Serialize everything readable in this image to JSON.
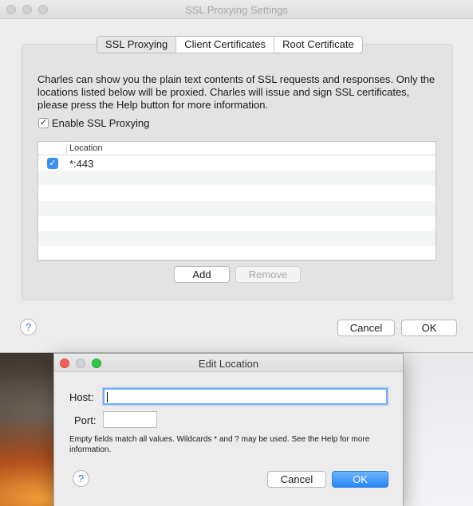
{
  "main_window": {
    "title": "SSL Proxying Settings",
    "tabs": [
      {
        "label": "SSL Proxying",
        "active": true
      },
      {
        "label": "Client Certificates",
        "active": false
      },
      {
        "label": "Root Certificate",
        "active": false
      }
    ],
    "description": "Charles can show you the plain text contents of SSL requests and responses. Only the locations listed below will be proxied. Charles will issue and sign SSL certificates, please press the Help button for more information.",
    "enable_checkbox": {
      "label": "Enable SSL Proxying",
      "checked": true
    },
    "table": {
      "column_header": "Location",
      "rows": [
        {
          "checked": true,
          "location": "*:443"
        }
      ]
    },
    "add_button": "Add",
    "remove_button": "Remove",
    "help_button": "?",
    "cancel_button": "Cancel",
    "ok_button": "OK"
  },
  "edit_dialog": {
    "title": "Edit Location",
    "host_label": "Host:",
    "host_value": "",
    "port_label": "Port:",
    "port_value": "",
    "hint": "Empty fields match all values. Wildcards * and ? may be used. See the Help for more information.",
    "help_button": "?",
    "cancel_button": "Cancel",
    "ok_button": "OK"
  },
  "icons": {
    "check_glyph": "✓"
  },
  "colors": {
    "accent": "#2a86f5",
    "close": "#fc5f57",
    "zoom": "#33c748"
  }
}
